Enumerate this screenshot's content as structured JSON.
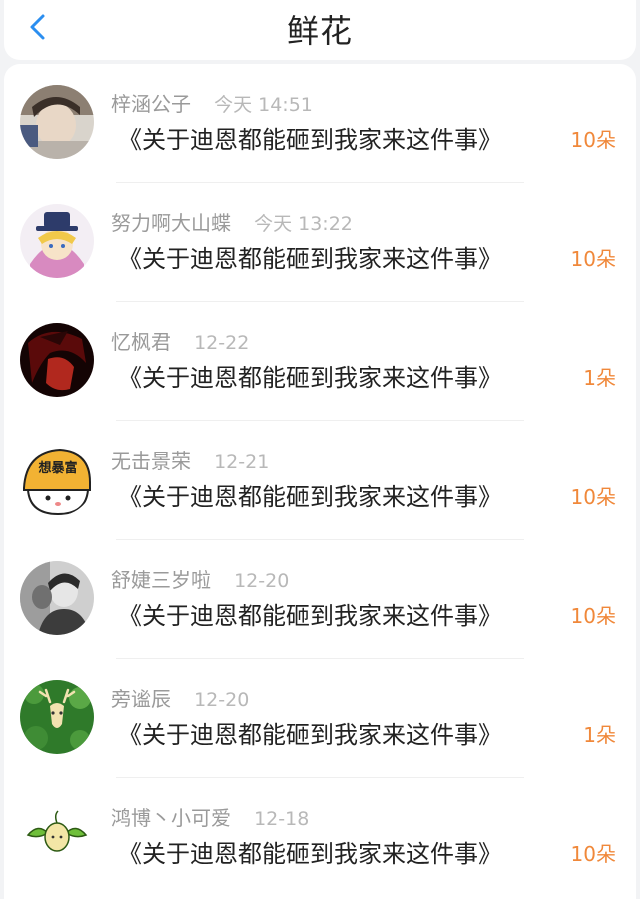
{
  "header": {
    "title": "鲜花",
    "back_icon": "chevron-left-icon",
    "accent": "#2b8ef0"
  },
  "colors": {
    "count": "#f0883a",
    "name": "#9a9a9a",
    "time": "#b8b8b8"
  },
  "items": [
    {
      "name": "梓涵公子",
      "time": "今天 14:51",
      "book": "《关于迪恩都能砸到我家来这件事》",
      "count": "10朵",
      "avatar": "photo-avatar"
    },
    {
      "name": "努力啊大山蝶",
      "time": "今天 13:22",
      "book": "《关于迪恩都能砸到我家来这件事》",
      "count": "10朵",
      "avatar": "anime-hat-avatar"
    },
    {
      "name": "忆枫君",
      "time": "12-22",
      "book": "《关于迪恩都能砸到我家来这件事》",
      "count": "1朵",
      "avatar": "dark-red-avatar"
    },
    {
      "name": "无击景荣",
      "time": "12-21",
      "book": "《关于迪恩都能砸到我家来这件事》",
      "count": "10朵",
      "avatar": "cartoon-helmet-avatar",
      "avatar_text": "想暴富"
    },
    {
      "name": "舒婕三岁啦",
      "time": "12-20",
      "book": "《关于迪恩都能砸到我家来这件事》",
      "count": "10朵",
      "avatar": "bw-photo-avatar"
    },
    {
      "name": "旁谧辰",
      "time": "12-20",
      "book": "《关于迪恩都能砸到我家来这件事》",
      "count": "1朵",
      "avatar": "deer-avatar"
    },
    {
      "name": "鸿博丶小可爱",
      "time": "12-18",
      "book": "《关于迪恩都能砸到我家来这件事》",
      "count": "10朵",
      "avatar": "sprout-avatar"
    }
  ]
}
